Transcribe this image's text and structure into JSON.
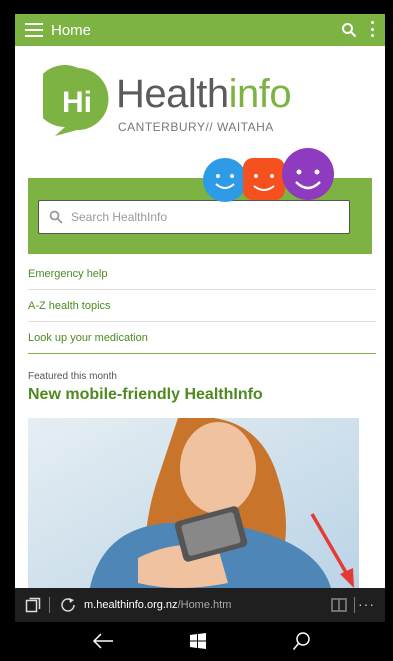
{
  "appbar": {
    "title": "Home"
  },
  "logo": {
    "brand_main": "Health",
    "brand_accent": "info",
    "subtitle": "CANTERBURY// WAITAHA"
  },
  "search": {
    "placeholder": "Search HealthInfo"
  },
  "links": [
    {
      "label": "Emergency help"
    },
    {
      "label": "A-Z health topics"
    },
    {
      "label": "Look up your medication"
    }
  ],
  "featured": {
    "label": "Featured this month",
    "title": "New mobile-friendly HealthInfo"
  },
  "browser": {
    "url_domain": "m.healthinfo.org.nz",
    "url_path": "/Home.htm",
    "more_label": "···"
  },
  "colors": {
    "brand_green": "#7cb342",
    "link_green": "#4f8a20",
    "arrow_red": "#e53935"
  }
}
